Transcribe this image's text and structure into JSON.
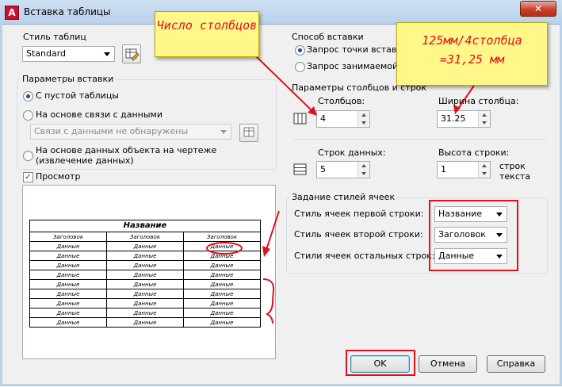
{
  "window": {
    "app_icon_letter": "A",
    "title": "Вставка таблицы",
    "close_symbol": "✕"
  },
  "table_style": {
    "label": "Стиль таблиц",
    "value": "Standard"
  },
  "insert_options": {
    "group_title": "Параметры вставки",
    "radio_empty": "С пустой таблицы",
    "radio_data_link": "На основе связи с данными",
    "data_link_combo": "Связи с данными не обнаружены",
    "radio_object_data": "На основе данных объекта на чертеже (извлечение данных)",
    "selected": "empty"
  },
  "preview": {
    "checkbox_label": "Просмотр",
    "checked": true,
    "table_title": "Название",
    "header_cells": [
      "Заголовок",
      "Заголовок",
      "Заголовок"
    ],
    "data_cells": [
      [
        "Данные",
        "Данные",
        "Данные"
      ],
      [
        "Данные",
        "Данные",
        "Данные"
      ],
      [
        "Данные",
        "Данные",
        "Данные"
      ],
      [
        "Данные",
        "Данные",
        "Данные"
      ],
      [
        "Данные",
        "Данные",
        "Данные"
      ],
      [
        "Данные",
        "Данные",
        "Данные"
      ],
      [
        "Данные",
        "Данные",
        "Данные"
      ],
      [
        "Данные",
        "Данные",
        "Данные"
      ],
      [
        "Данные",
        "Данные",
        "Данные"
      ]
    ]
  },
  "insert_method": {
    "group_title": "Способ вставки",
    "radio_point": "Запрос точки вставки",
    "radio_area": "Запрос занимаемой обл",
    "selected": "point"
  },
  "columns_rows": {
    "group_title": "Параметры столбцов и строк",
    "columns_label": "Столбцов:",
    "columns_value": "4",
    "column_width_label": "Ширина столбца:",
    "column_width_value": "31.25",
    "data_rows_label": "Строк данных:",
    "data_rows_value": "5",
    "row_height_label": "Высота строки:",
    "row_height_value": "1",
    "row_height_unit": "строк текста"
  },
  "cell_styles": {
    "group_title": "Задание стилей ячеек",
    "first_row_label": "Стиль ячеек первой строки:",
    "first_row_value": "Название",
    "second_row_label": "Стиль ячеек второй строки:",
    "second_row_value": "Заголовок",
    "other_rows_label": "Стили ячеек остальных строк:",
    "other_rows_value": "Данные"
  },
  "buttons": {
    "ok": "OK",
    "cancel": "Отмена",
    "help": "Справка"
  },
  "annotations": {
    "callout_columns": "Число столбцов",
    "callout_width": "125мм/4столбца =31,25 мм",
    "color": "#e0101a"
  }
}
